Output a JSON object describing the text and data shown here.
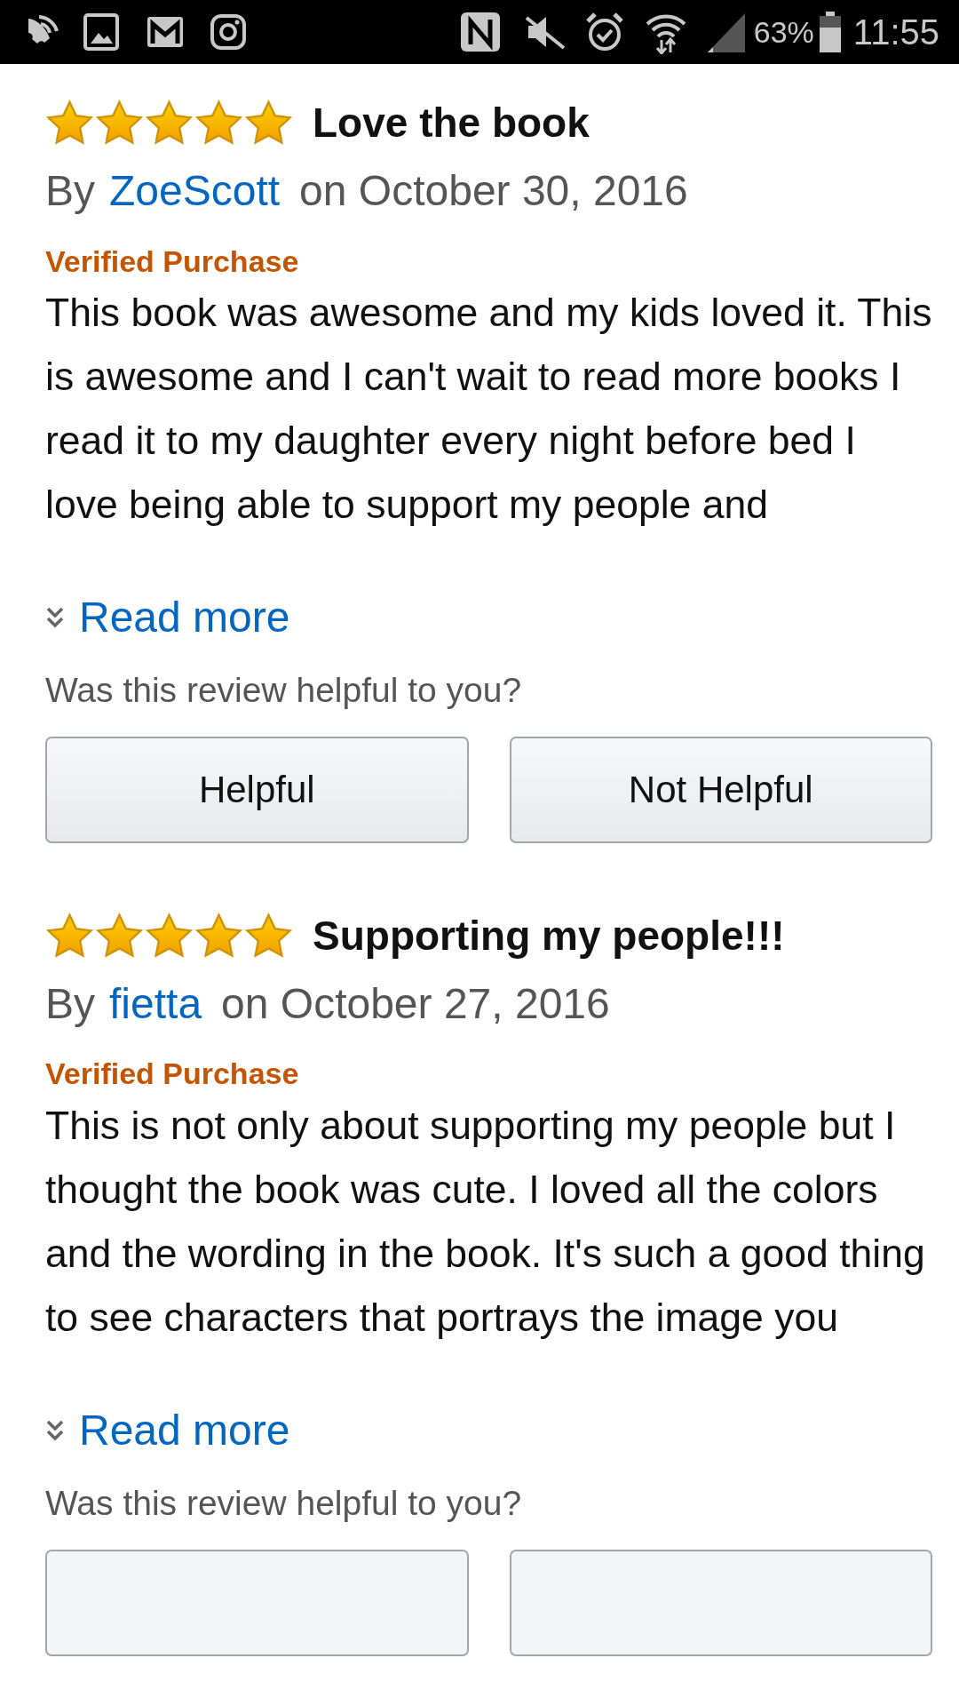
{
  "status_bar": {
    "battery": "63%",
    "time": "11:55"
  },
  "reviews": [
    {
      "stars": 5,
      "title": "Love the book",
      "by": "By",
      "author": "ZoeScott",
      "date": "on October 30, 2016",
      "badge": "Verified Purchase",
      "body": "This book was awesome and my kids loved it. This is awesome and I can't wait to read more books I read it to my daughter every night before bed I love being able to support my people and",
      "read_more": "Read more",
      "question": "Was this review helpful to you?",
      "buttons": [
        {
          "label": "Helpful"
        },
        {
          "label": "Not Helpful"
        }
      ]
    },
    {
      "stars": 5,
      "title": "Supporting my people!!!",
      "by": "By",
      "author": "fietta",
      "date": "on October 27, 2016",
      "badge": "Verified Purchase",
      "body": "This is not only about supporting my people but I thought the book was cute. I loved all the colors and the wording in the book. It's such a good thing to see characters that portrays the image you",
      "read_more": "Read more",
      "question": "Was this review helpful to you?",
      "buttons": [
        {
          "kind": "cut"
        },
        {
          "kind": "cut"
        }
      ]
    }
  ]
}
